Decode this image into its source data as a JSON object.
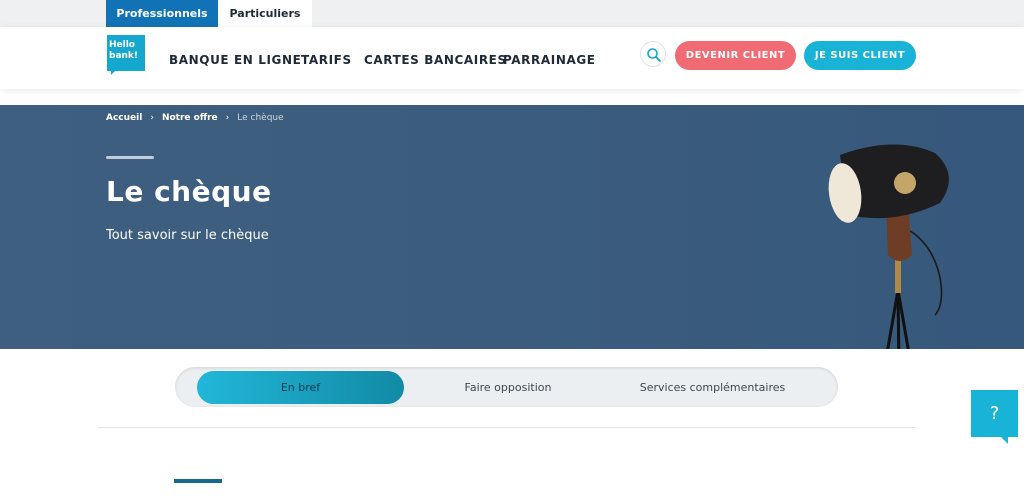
{
  "segment_tabs": [
    "Professionnels",
    "Particuliers"
  ],
  "logo": {
    "line1": "Hello",
    "line2": "bank!"
  },
  "nav": [
    "BANQUE EN LIGNE",
    "TARIFS",
    "CARTES BANCAIRES",
    "PARRAINAGE"
  ],
  "actions": {
    "become_client": "DEVENIR CLIENT",
    "am_client": "JE SUIS CLIENT"
  },
  "breadcrumb": [
    "Accueil",
    "Notre offre",
    "Le chèque"
  ],
  "hero": {
    "title": "Le chèque",
    "subtitle": "Tout savoir sur le chèque"
  },
  "content_tabs": {
    "active": "En bref",
    "items": [
      "En bref",
      "Faire opposition",
      "Services complémentaires"
    ]
  },
  "help": {
    "label": "?"
  },
  "colors": {
    "brand_blue": "#1173b6",
    "cyan": "#18b3d6",
    "coral": "#f06b73",
    "hero": "#3b5c7e"
  }
}
